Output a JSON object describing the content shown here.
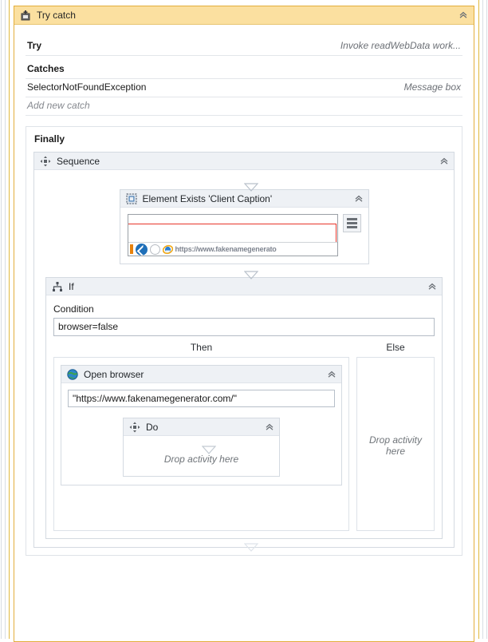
{
  "colors": {
    "trycatch_header_bg": "#fbe0a0",
    "trycatch_border": "#e2ae3c",
    "activity_header_bg": "#eef1f5",
    "activity_border": "#d4dae1",
    "selection_red": "#e8342a",
    "text": "#1e1e1e",
    "muted_text": "#6c7076"
  },
  "trycatch": {
    "icon": "try-catch-icon",
    "title": "Try catch",
    "collapse_icon": "chevron-up-icon",
    "try": {
      "label": "Try",
      "value": "Invoke readWebData work..."
    },
    "catches": {
      "label": "Catches",
      "entries": [
        {
          "exception": "SelectorNotFoundException",
          "handler": "Message box"
        }
      ],
      "add_new_label": "Add new catch"
    },
    "finally": {
      "label": "Finally"
    }
  },
  "sequence": {
    "icon": "sequence-move-icon",
    "title": "Sequence",
    "collapse_icon": "chevron-up-icon",
    "connector_icon": "arrow-down-triangle-icon"
  },
  "element_exists": {
    "icon": "element-exists-selection-icon",
    "title": "Element Exists 'Client Caption'",
    "collapse_icon": "chevron-up-icon",
    "preview": {
      "name": "target-screenshot-preview",
      "browser_url_text": "https://www.fakenamegenerato",
      "highlight_color": "#e8342a"
    },
    "menu_button_icon": "hamburger-menu-icon"
  },
  "if_activity": {
    "icon": "if-branch-icon",
    "title": "If",
    "collapse_icon": "chevron-up-icon",
    "condition": {
      "label": "Condition",
      "value": "browser=false"
    },
    "then": {
      "label": "Then"
    },
    "else": {
      "label": "Else",
      "drop_hint": "Drop activity here"
    }
  },
  "open_browser": {
    "icon": "globe-icon",
    "title": "Open browser",
    "collapse_icon": "chevron-up-icon",
    "url_value": "\"https://www.fakenamegenerator.com/\""
  },
  "do_activity": {
    "icon": "sequence-move-icon",
    "title": "Do",
    "collapse_icon": "chevron-up-icon",
    "connector_icon": "arrow-down-triangle-icon",
    "drop_hint": "Drop activity here"
  }
}
